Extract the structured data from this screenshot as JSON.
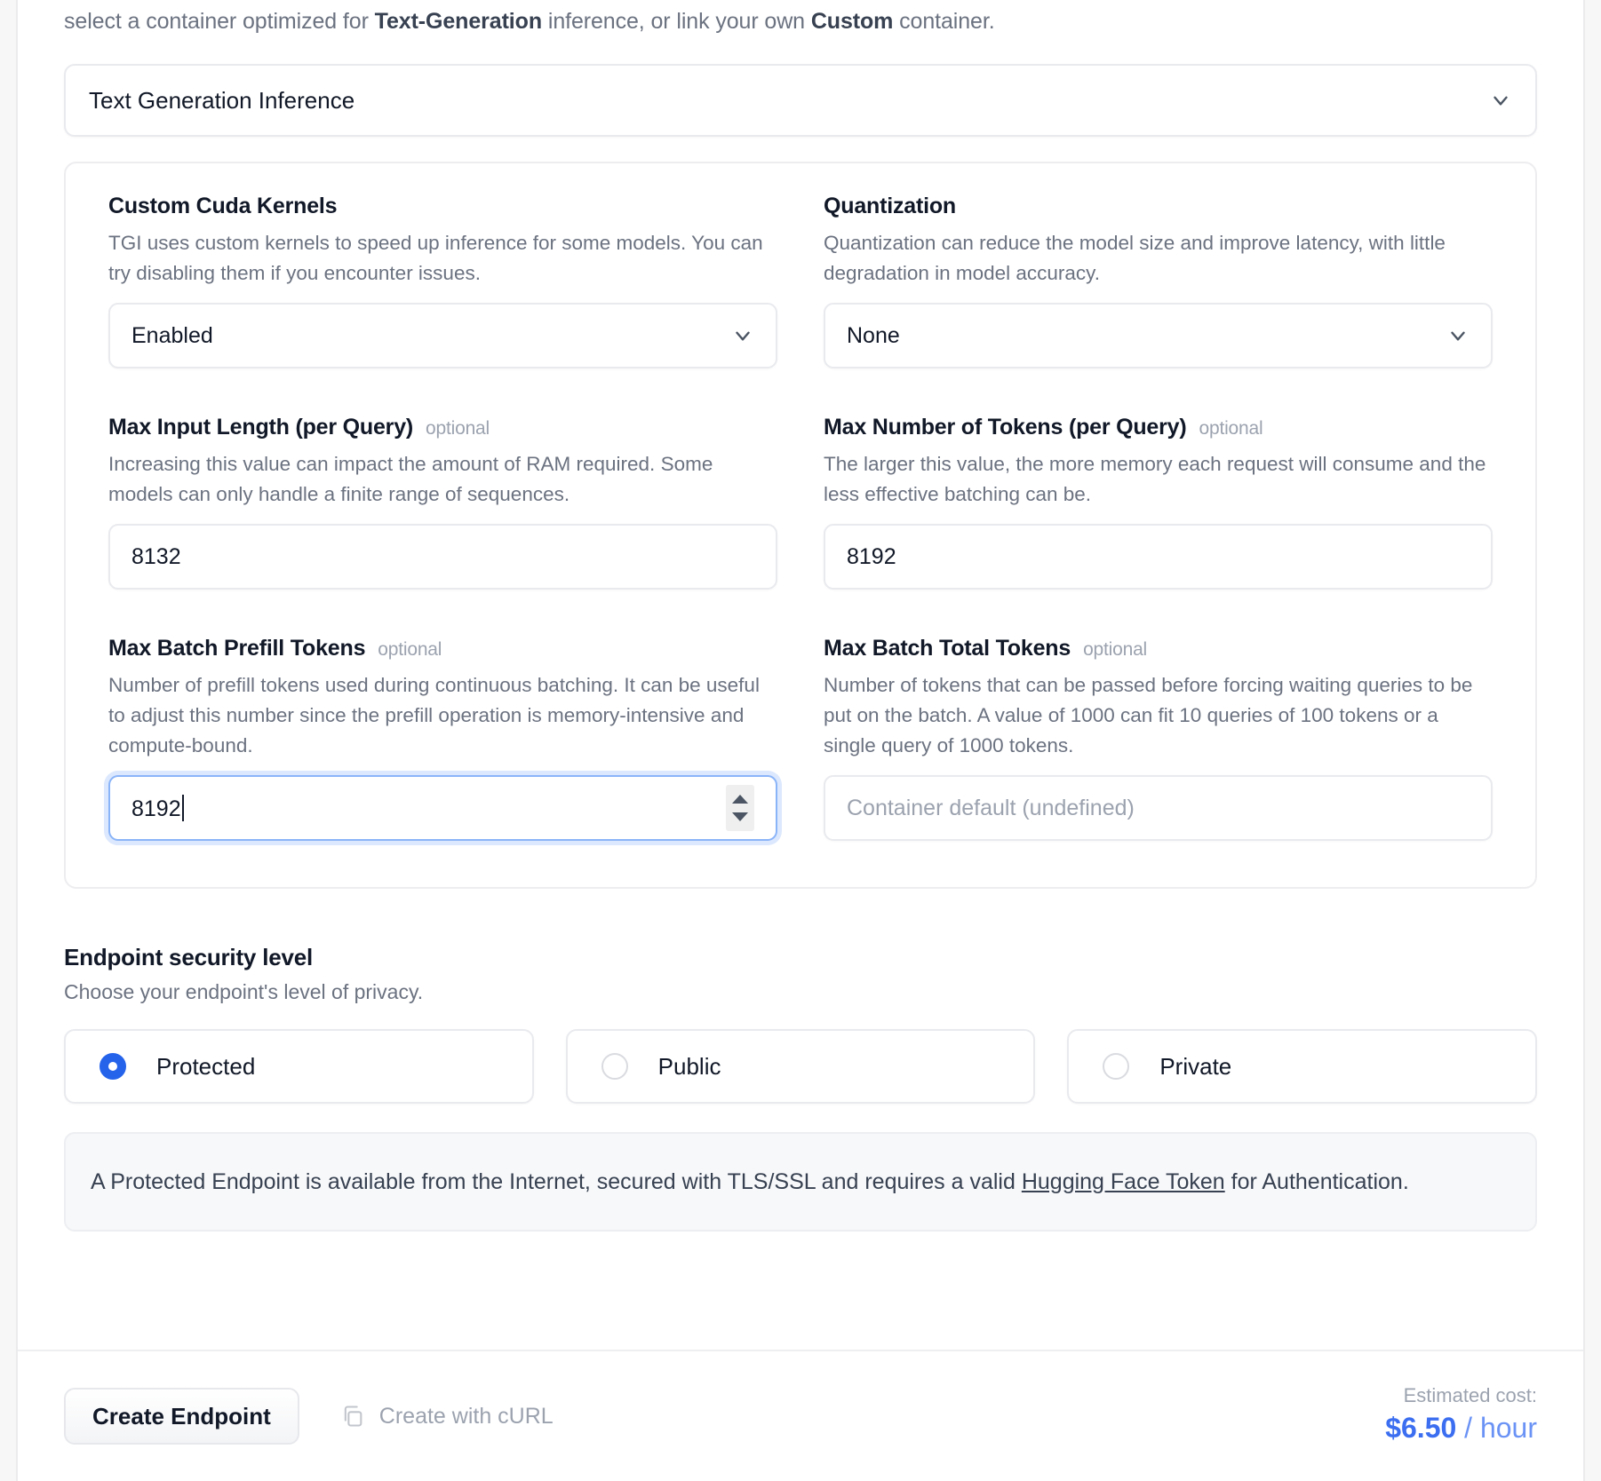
{
  "intro": {
    "prefix": "select a container optimized for ",
    "bold1": "Text-Generation",
    "middle": " inference, or link your own ",
    "bold2": "Custom",
    "suffix": " container."
  },
  "container_select": {
    "value": "Text Generation Inference",
    "icon": "chevron-down-icon"
  },
  "fields": [
    {
      "label": "Custom Cuda Kernels",
      "optional": "",
      "desc": "TGI uses custom kernels to speed up inference for some models. You can try disabling them if you encounter issues.",
      "value": "Enabled",
      "type": "select"
    },
    {
      "label": "Quantization",
      "optional": "",
      "desc": "Quantization can reduce the model size and improve latency, with little degradation in model accuracy.",
      "value": "None",
      "type": "select"
    },
    {
      "label": "Max Input Length (per Query)",
      "optional": "optional",
      "desc": "Increasing this value can impact the amount of RAM required. Some models can only handle a finite range of sequences.",
      "value": "8132",
      "type": "number"
    },
    {
      "label": "Max Number of Tokens (per Query)",
      "optional": "optional",
      "desc": "The larger this value, the more memory each request will consume and the less effective batching can be.",
      "value": "8192",
      "type": "number"
    },
    {
      "label": "Max Batch Prefill Tokens",
      "optional": "optional",
      "desc": "Number of prefill tokens used during continuous batching. It can be useful to adjust this number since the prefill operation is memory-intensive and compute-bound.",
      "value": "8192",
      "type": "number-focused"
    },
    {
      "label": "Max Batch Total Tokens",
      "optional": "optional",
      "desc": "Number of tokens that can be passed before forcing waiting queries to be put on the batch. A value of 1000 can fit 10 queries of 100 tokens or a single query of 1000 tokens.",
      "value": "",
      "placeholder": "Container default (undefined)",
      "type": "number-empty"
    }
  ],
  "security": {
    "title": "Endpoint security level",
    "subtitle": "Choose your endpoint's level of privacy.",
    "options": [
      {
        "label": "Protected",
        "selected": true
      },
      {
        "label": "Public",
        "selected": false
      },
      {
        "label": "Private",
        "selected": false
      }
    ],
    "info_prefix": "A Protected Endpoint is available from the Internet, secured with TLS/SSL and requires a valid ",
    "info_link": "Hugging Face Token",
    "info_suffix": " for Authentication."
  },
  "footer": {
    "create_label": "Create Endpoint",
    "curl_label": "Create with cURL",
    "curl_icon": "copy-icon",
    "cost_label": "Estimated cost:",
    "cost_amount": "$6.50",
    "cost_unit": " / hour"
  },
  "colors": {
    "accent": "#2563eb",
    "cost": "#3b6ef0",
    "focus_border": "#8ab4f8"
  }
}
